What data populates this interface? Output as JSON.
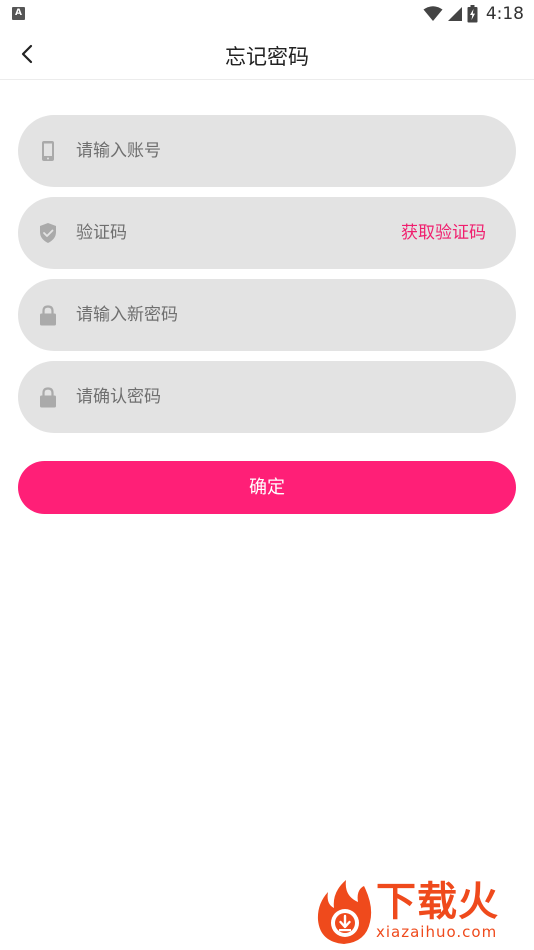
{
  "status_bar": {
    "left_badge": "A",
    "time": "4:18",
    "icons": [
      "wifi-icon",
      "signal-icon",
      "battery-icon"
    ]
  },
  "header": {
    "back_icon": "chevron-left-icon",
    "title": "忘记密码"
  },
  "form": {
    "account": {
      "icon": "phone-icon",
      "placeholder": "请输入账号",
      "value": ""
    },
    "code": {
      "icon": "shield-icon",
      "placeholder": "验证码",
      "value": "",
      "get_code_label": "获取验证码"
    },
    "new_password": {
      "icon": "lock-icon",
      "placeholder": "请输入新密码",
      "value": ""
    },
    "confirm_password": {
      "icon": "lock-icon",
      "placeholder": "请确认密码",
      "value": ""
    }
  },
  "confirm_button": {
    "label": "确定"
  },
  "watermark": {
    "logo": "flame-logo",
    "name_cn": "下载火",
    "name_en": "xiazaihuo.com"
  },
  "colors": {
    "accent": "#ff1f77",
    "link": "#f01f6e",
    "field_bg": "#e3e3e3",
    "icon_gray": "#aaaaaa"
  }
}
